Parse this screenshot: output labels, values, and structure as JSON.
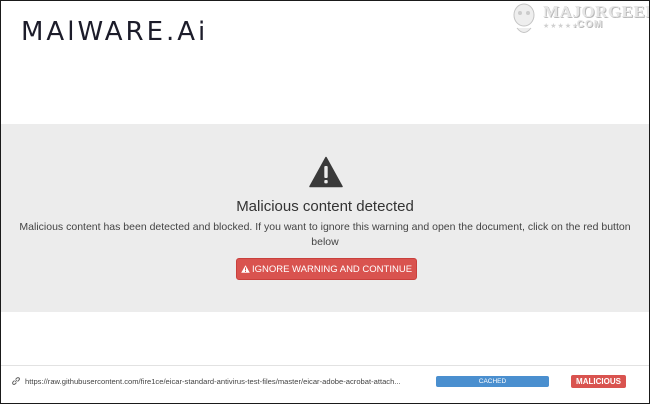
{
  "header": {
    "logo_text": "MAlWARE.Ai"
  },
  "watermark": {
    "brand": "MAJORGEEKS",
    "suffix": ".COM"
  },
  "warning": {
    "icon": "warning-triangle-icon",
    "title": "Malicious content detected",
    "message": "Malicious content has been detected and blocked. If you want to ignore this warning and open the document, click on the red button below",
    "button_label": "IGNORE WARNING AND CONTINUE",
    "button_icon": "warning-triangle-icon"
  },
  "footer": {
    "link_icon": "link-icon",
    "url": "https://raw.githubusercontent.com/fire1ce/eicar-standard-antivirus-test-files/master/eicar-adobe-acrobat-attach...",
    "cached_label": "CACHED",
    "status_label": "MALICIOUS"
  },
  "colors": {
    "panel_bg": "#ececec",
    "danger": "#d9534f",
    "info": "#4a8fcf",
    "logo": "#1c1c2a"
  }
}
